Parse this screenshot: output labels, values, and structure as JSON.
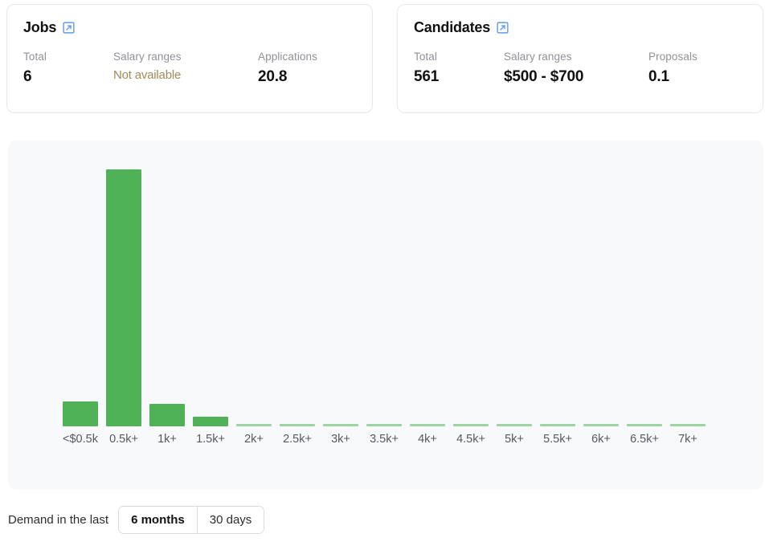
{
  "cards": [
    {
      "title": "Jobs",
      "link_icon": "external-link-icon",
      "metrics": [
        {
          "label": "Total",
          "value": "6",
          "muted": false
        },
        {
          "label": "Salary ranges",
          "value": "Not available",
          "muted": true
        },
        {
          "label": "Applications",
          "value": "20.8",
          "muted": false
        }
      ]
    },
    {
      "title": "Candidates",
      "link_icon": "external-link-icon",
      "metrics": [
        {
          "label": "Total",
          "value": "561",
          "muted": false
        },
        {
          "label": "Salary ranges",
          "value": "$500 - $700",
          "muted": false
        },
        {
          "label": "Proposals",
          "value": "0.1",
          "muted": false
        }
      ]
    }
  ],
  "chart_data": {
    "type": "bar",
    "title": "",
    "xlabel": "",
    "ylabel": "",
    "grid": false,
    "legend": null,
    "bar_color": "#50b257",
    "tiny_bar_color": "#9ed3a2",
    "categories": [
      "<$0.5k",
      "0.5k+",
      "1k+",
      "1.5k+",
      "2k+",
      "2.5k+",
      "3k+",
      "3.5k+",
      "4k+",
      "4.5k+",
      "5k+",
      "5.5k+",
      "6k+",
      "6.5k+",
      "7k+"
    ],
    "values": [
      31,
      320,
      28,
      12,
      3,
      3,
      3,
      3,
      3,
      3,
      3,
      3,
      3,
      3,
      3
    ],
    "ylim": [
      0,
      338
    ]
  },
  "footer": {
    "demand_label": "Demand in the last",
    "options": [
      {
        "label": "6 months",
        "selected": true
      },
      {
        "label": "30 days",
        "selected": false
      }
    ]
  }
}
